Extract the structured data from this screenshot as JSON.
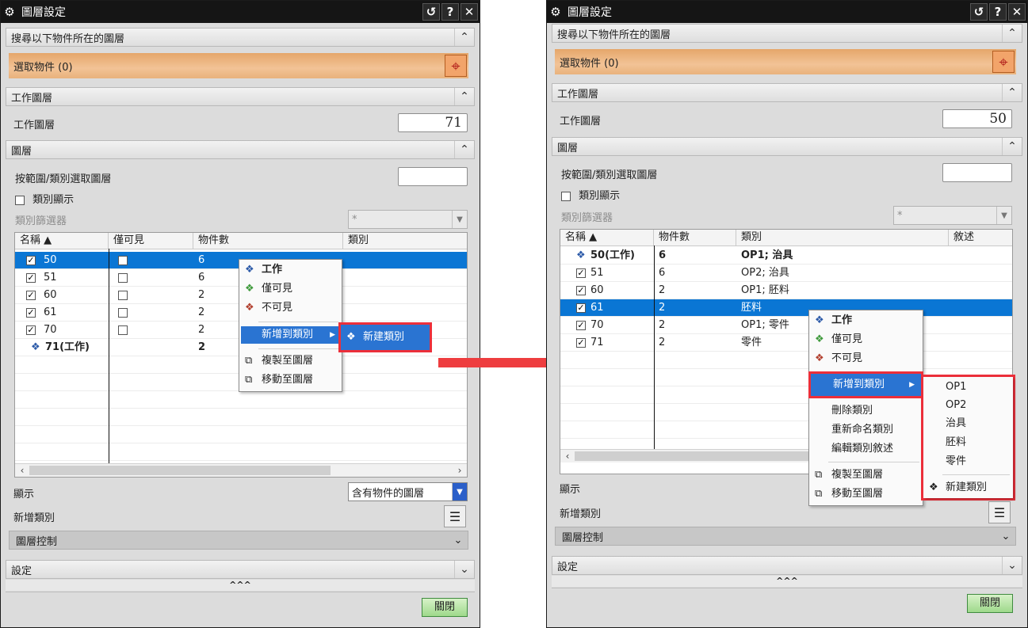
{
  "left_dialog": {
    "title": "圖層設定",
    "title_buttons": [
      "↺",
      "?",
      "✕"
    ],
    "sec_find": "搜尋以下物件所在的圖層",
    "select_objects": "選取物件 (0)",
    "sec_work_layer": "工作圖層",
    "work_layer_label": "工作圖層",
    "work_layer_value": "71",
    "sec_layers": "圖層",
    "range_label": "按範圍/類別選取圖層",
    "range_value": "",
    "category_show": "類別顯示",
    "category_filter": "類別篩選器",
    "category_filter_value": "*",
    "columns": [
      "名稱 ▲",
      "僅可見",
      "物件數",
      "類別"
    ],
    "rows": [
      {
        "name": "50",
        "count": "6",
        "checked": "☑"
      },
      {
        "name": "51",
        "count": "6",
        "checked": "☑"
      },
      {
        "name": "60",
        "count": "2",
        "checked": "☑"
      },
      {
        "name": "61",
        "count": "2",
        "checked": "☑"
      },
      {
        "name": "70",
        "count": "2",
        "checked": "☑"
      },
      {
        "name": "71(工作)",
        "count": "2",
        "checked": ""
      }
    ],
    "display_label": "顯示",
    "display_value": "含有物件的圖層",
    "add_category_label": "新增類別",
    "layer_control": "圖層控制",
    "sec_settings": "設定",
    "expander": "^^^",
    "close_button": "關閉",
    "menu": {
      "work": "工作",
      "visible_only": "僅可見",
      "invisible": "不可見",
      "add_to_category": "新增到類別",
      "copy_to_layer": "複製至圖層",
      "move_to_layer": "移動至圖層"
    },
    "submenu": {
      "new_category": "新建類別"
    }
  },
  "right_dialog": {
    "title": "圖層設定",
    "title_buttons": [
      "↺",
      "?",
      "✕"
    ],
    "sec_find": "搜尋以下物件所在的圖層",
    "select_objects": "選取物件 (0)",
    "sec_work_layer": "工作圖層",
    "work_layer_label": "工作圖層",
    "work_layer_value": "50",
    "sec_layers": "圖層",
    "range_label": "按範圍/類別選取圖層",
    "range_value": "",
    "category_show": "類別顯示",
    "category_filter": "類別篩選器",
    "category_filter_value": "*",
    "columns": [
      "名稱 ▲",
      "物件數",
      "類別",
      "敘述"
    ],
    "rows": [
      {
        "name": "50(工作)",
        "count": "6",
        "category": "OP1; 治具",
        "checked": ""
      },
      {
        "name": "51",
        "count": "6",
        "category": "OP2; 治具",
        "checked": "☑"
      },
      {
        "name": "60",
        "count": "2",
        "category": "OP1; 胚料",
        "checked": "☑"
      },
      {
        "name": "61",
        "count": "2",
        "category": "胚料",
        "checked": "☑"
      },
      {
        "name": "70",
        "count": "2",
        "category": "OP1; 零件",
        "checked": "☑"
      },
      {
        "name": "71",
        "count": "2",
        "category": "零件",
        "checked": "☑"
      }
    ],
    "display_label": "顯示",
    "add_category_label": "新增類別",
    "layer_control": "圖層控制",
    "sec_settings": "設定",
    "expander": "^^^",
    "close_button": "關閉",
    "menu": {
      "work": "工作",
      "visible_only": "僅可見",
      "invisible": "不可見",
      "add_to_category": "新增到類別",
      "delete_category": "刪除類別",
      "rename_category": "重新命名類別",
      "edit_category_desc": "編輯類別敘述",
      "copy_to_layer": "複製至圖層",
      "move_to_layer": "移動至圖層"
    },
    "submenu": {
      "op1": "OP1",
      "op2": "OP2",
      "fixture": "治具",
      "stock": "胚料",
      "part": "零件",
      "new_category": "新建類別"
    }
  },
  "colors": {
    "highlight": "#0a76d4",
    "annotation_red": "#ec2f3a",
    "select_bar": "#f2c396"
  }
}
